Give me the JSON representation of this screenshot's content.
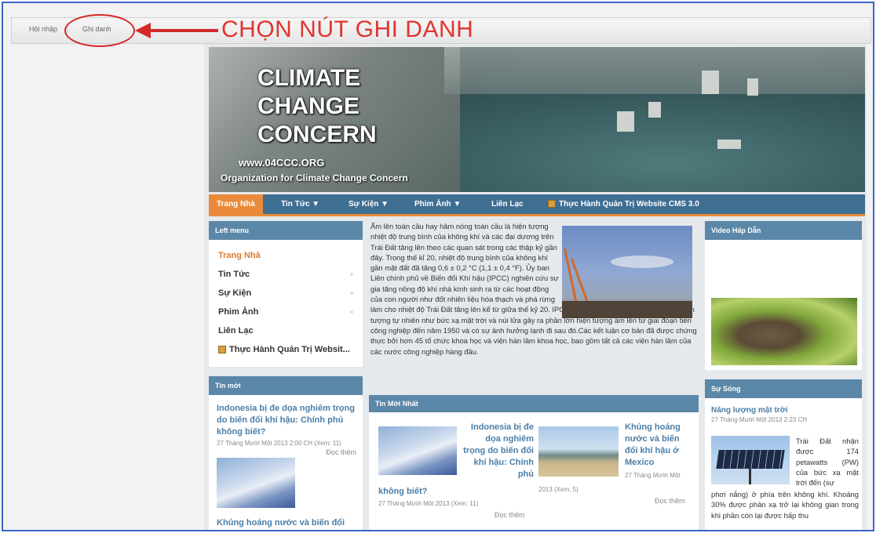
{
  "admin": {
    "login_label": "Hội nhập",
    "register_label": "Ghi danh"
  },
  "callout": {
    "text": "CHỌN NÚT GHI DANH",
    "color": "#e0352f"
  },
  "banner": {
    "title_line1": "CLIMATE",
    "title_line2": "CHANGE",
    "title_line3": "CONCERN",
    "url": "www.04CCC.ORG",
    "org": "Organization for Climate Change Concern"
  },
  "nav": {
    "items": [
      {
        "label": "Trang Nhà"
      },
      {
        "label": "Tin Tức ▼"
      },
      {
        "label": "Sự Kiện ▼"
      },
      {
        "label": "Phim Ảnh ▼"
      },
      {
        "label": "Liên Lạc"
      },
      {
        "label": "Thực Hành Quản Trị Website CMS 3.0"
      }
    ],
    "active_color": "#e98b3a",
    "bar_color": "#3f6e93"
  },
  "left_menu": {
    "heading": "Left menu",
    "items": [
      {
        "label": "Trang Nhà"
      },
      {
        "label": "Tin Tức"
      },
      {
        "label": "Sự Kiện"
      },
      {
        "label": "Phim Ảnh"
      },
      {
        "label": "Liên Lạc"
      },
      {
        "label": "Thực Hành Quản Trị Websit..."
      }
    ]
  },
  "left_news": {
    "heading": "Tin mới",
    "item1_title": "Indonesia bị đe dọa nghiêm trọng do biến đổi khí hậu: Chính phủ không biết?",
    "item1_meta": "27 Tháng Mười Một 2013 2:00 CH (Xem: 11)",
    "item1_more": "Đọc thêm",
    "item2_title": "Khủng hoảng nước và biến đổi khí"
  },
  "article": {
    "text_top": "Ấm lên toàn cầu hay hâm nóng toàn cầu là hiện tượng nhiệt độ trung bình của không khí và các đại dương trên Trái Đất tăng lên theo các quan sát trong các thập kỷ gần đây. Trong thế kỉ 20, nhiệt độ trung bình của không khí gần mặt đất đã tăng 0,6 ± 0,2 °C (1,1 ± 0,4 °F). Ủy ban Liên chính phủ về Biến đổi Khí hậu (IPCC) nghiên cứu sự gia tăng nồng độ khí nhà kính sinh ra từ các hoạt động của con người như đốt nhiên liệu hóa thạch và phá rừng",
    "text_bottom": "làm cho nhiệt độ Trái Đất tăng lên kể từ giữa thế kỷ 20. IPCC cũng nghiên cứu sự biến đổi các hiện tượng tự nhiên như bức xạ mặt trời và núi lửa gây ra phần lớn hiện tượng ấm lên từ giai đoạn tiền công nghiệp đến năm 1950 và có sự ảnh hưởng lạnh đi sau đó.Các kết luận cơ bản đã được chứng thực bởi hơn 45 tổ chức khoa học và viện hàn lâm khoa học, bao gồm tất cả các viện hàn lâm của các nước công nghiệp hàng đầu."
  },
  "tin_moi_nhat": {
    "heading": "Tin Mới Nhất",
    "item1_title_a": "Indonesia bị đe dọa nghiêm trọng do biến đổi khí hậu: Chính phủ",
    "item1_title_b": "không biết?",
    "item1_meta": "27 Tháng Mười Một 2013 (Xem: 11)",
    "item1_more": "Đọc thêm",
    "item2_title": "Khủng hoảng nước và biến đổi khí hậu ở Mexico",
    "item2_date": "27 Tháng Mười Một",
    "item2_views": "2013 (Xem: 5)",
    "item2_more": "Đọc thêm"
  },
  "right": {
    "video_heading": "Video Hấp Dẫn",
    "life_heading": "Sự Sống",
    "life_title": "Năng lượng mặt trời",
    "life_meta": "27 Tháng Mười Một 2013 2:23 CH",
    "life_text_side": "Trái Đất nhận được 174 petawatts (PW) của bức xạ mặt trời đến (sự",
    "life_text_bottom": "phơi nắng) ở phía trên không khí. Khoảng 30% được phản xạ trở lại không gian trong khi phần còn lại được hấp thu"
  }
}
